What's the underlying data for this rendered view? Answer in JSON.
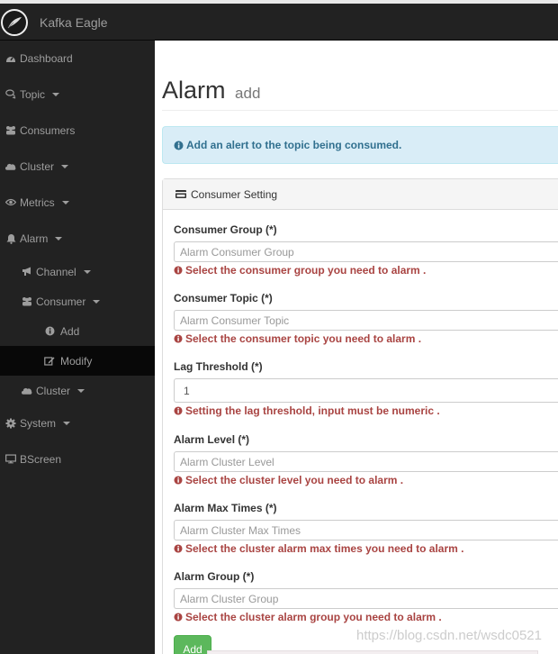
{
  "app": {
    "brand": "Kafka Eagle"
  },
  "sidebar": {
    "items": [
      {
        "label": "Dashboard",
        "icon": "dashboard-icon",
        "has_caret": false
      },
      {
        "label": "Topic",
        "icon": "comments-icon",
        "has_caret": true
      },
      {
        "label": "Consumers",
        "icon": "users-icon",
        "has_caret": false
      },
      {
        "label": "Cluster",
        "icon": "cloud-icon",
        "has_caret": true
      },
      {
        "label": "Metrics",
        "icon": "eye-icon",
        "has_caret": true
      },
      {
        "label": "Alarm",
        "icon": "bell-icon",
        "has_caret": true
      },
      {
        "label": "Channel",
        "icon": "bullhorn-icon",
        "has_caret": true
      },
      {
        "label": "Consumer",
        "icon": "users-icon",
        "has_caret": true
      },
      {
        "label": "Add",
        "icon": "info-circle-icon",
        "has_caret": false
      },
      {
        "label": "Modify",
        "icon": "edit-icon",
        "has_caret": false,
        "active": true
      },
      {
        "label": "Cluster",
        "icon": "cloud-icon",
        "has_caret": true
      },
      {
        "label": "System",
        "icon": "gear-icon",
        "has_caret": true
      },
      {
        "label": "BScreen",
        "icon": "desktop-icon",
        "has_caret": false
      }
    ]
  },
  "page": {
    "title": "Alarm",
    "subtitle": "add",
    "alert": "Add an alert to the topic being consumed.",
    "panel_title": "Consumer Setting",
    "fields": [
      {
        "label": "Consumer Group (*)",
        "placeholder": "Alarm Consumer Group",
        "value": "",
        "help": "Select the consumer group you need to alarm ."
      },
      {
        "label": "Consumer Topic (*)",
        "placeholder": "Alarm Consumer Topic",
        "value": "",
        "help": "Select the consumer topic you need to alarm ."
      },
      {
        "label": "Lag Threshold (*)",
        "placeholder": "",
        "value": "1",
        "help": "Setting the lag threshold, input must be numeric ."
      },
      {
        "label": "Alarm Level (*)",
        "placeholder": "Alarm Cluster Level",
        "value": "",
        "help": "Select the cluster level you need to alarm ."
      },
      {
        "label": "Alarm Max Times (*)",
        "placeholder": "Alarm Cluster Max Times",
        "value": "",
        "help": "Select the cluster alarm max times you need to alarm ."
      },
      {
        "label": "Alarm Group (*)",
        "placeholder": "Alarm Cluster Group",
        "value": "",
        "help": "Select the cluster alarm group you need to alarm ."
      }
    ],
    "submit_label": "Add"
  },
  "watermark": "https://blog.csdn.net/wsdc0521",
  "colors": {
    "navbar_bg": "#222222",
    "sidebar_text": "#9d9d9d",
    "alert_bg": "#d9edf7",
    "alert_text": "#31708f",
    "help_text": "#a94442",
    "button_success": "#5cb85c"
  }
}
